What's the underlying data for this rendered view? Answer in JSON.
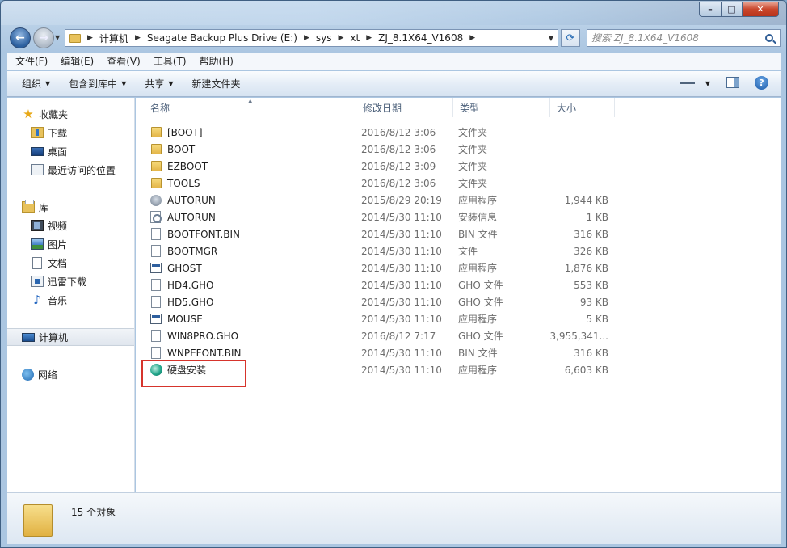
{
  "window": {
    "controls": {
      "minimize": "–",
      "maximize": "□",
      "close": "✕"
    }
  },
  "nav": {
    "back_icon": "back-arrow-icon",
    "forward_icon": "forward-arrow-icon",
    "breadcrumb": [
      "计算机",
      "Seagate Backup Plus Drive (E:)",
      "sys",
      "xt",
      "ZJ_8.1X64_V1608"
    ],
    "search_placeholder": "搜索 ZJ_8.1X64_V1608"
  },
  "menu": [
    "文件(F)",
    "编辑(E)",
    "查看(V)",
    "工具(T)",
    "帮助(H)"
  ],
  "toolbar": {
    "organize": "组织",
    "include_library": "包含到库中",
    "share": "共享",
    "new_folder": "新建文件夹"
  },
  "sidebar": {
    "favorites": {
      "label": "收藏夹",
      "items": [
        "下载",
        "桌面",
        "最近访问的位置"
      ]
    },
    "libraries": {
      "label": "库",
      "items": [
        "视频",
        "图片",
        "文档",
        "迅雷下载",
        "音乐"
      ]
    },
    "computer": "计算机",
    "network": "网络"
  },
  "columns": {
    "name": "名称",
    "date": "修改日期",
    "type": "类型",
    "size": "大小"
  },
  "files": [
    {
      "name": "[BOOT]",
      "date": "2016/8/12 3:06",
      "type": "文件夹",
      "size": "",
      "icon": "folder-icon"
    },
    {
      "name": "BOOT",
      "date": "2016/8/12 3:06",
      "type": "文件夹",
      "size": "",
      "icon": "folder-icon"
    },
    {
      "name": "EZBOOT",
      "date": "2016/8/12 3:09",
      "type": "文件夹",
      "size": "",
      "icon": "folder-icon"
    },
    {
      "name": "TOOLS",
      "date": "2016/8/12 3:06",
      "type": "文件夹",
      "size": "",
      "icon": "folder-icon"
    },
    {
      "name": "AUTORUN",
      "date": "2015/8/29 20:19",
      "type": "应用程序",
      "size": "1,944 KB",
      "icon": "autorun-exe-icon"
    },
    {
      "name": "AUTORUN",
      "date": "2014/5/30 11:10",
      "type": "安装信息",
      "size": "1 KB",
      "icon": "setup-info-icon"
    },
    {
      "name": "BOOTFONT.BIN",
      "date": "2014/5/30 11:10",
      "type": "BIN 文件",
      "size": "316 KB",
      "icon": "file-icon"
    },
    {
      "name": "BOOTMGR",
      "date": "2014/5/30 11:10",
      "type": "文件",
      "size": "326 KB",
      "icon": "file-icon"
    },
    {
      "name": "GHOST",
      "date": "2014/5/30 11:10",
      "type": "应用程序",
      "size": "1,876 KB",
      "icon": "app-icon"
    },
    {
      "name": "HD4.GHO",
      "date": "2014/5/30 11:10",
      "type": "GHO 文件",
      "size": "553 KB",
      "icon": "file-icon"
    },
    {
      "name": "HD5.GHO",
      "date": "2014/5/30 11:10",
      "type": "GHO 文件",
      "size": "93 KB",
      "icon": "file-icon"
    },
    {
      "name": "MOUSE",
      "date": "2014/5/30 11:10",
      "type": "应用程序",
      "size": "5 KB",
      "icon": "app-icon"
    },
    {
      "name": "WIN8PRO.GHO",
      "date": "2016/8/12 7:17",
      "type": "GHO 文件",
      "size": "3,955,341...",
      "icon": "file-icon"
    },
    {
      "name": "WNPEFONT.BIN",
      "date": "2014/5/30 11:10",
      "type": "BIN 文件",
      "size": "316 KB",
      "icon": "file-icon"
    },
    {
      "name": "硬盘安装",
      "date": "2014/5/30 11:10",
      "type": "应用程序",
      "size": "6,603 KB",
      "icon": "disk-install-icon"
    }
  ],
  "status": {
    "text": "15 个对象"
  },
  "colors": {
    "highlight": "#d6342c",
    "selection": "#e0e6ee"
  }
}
